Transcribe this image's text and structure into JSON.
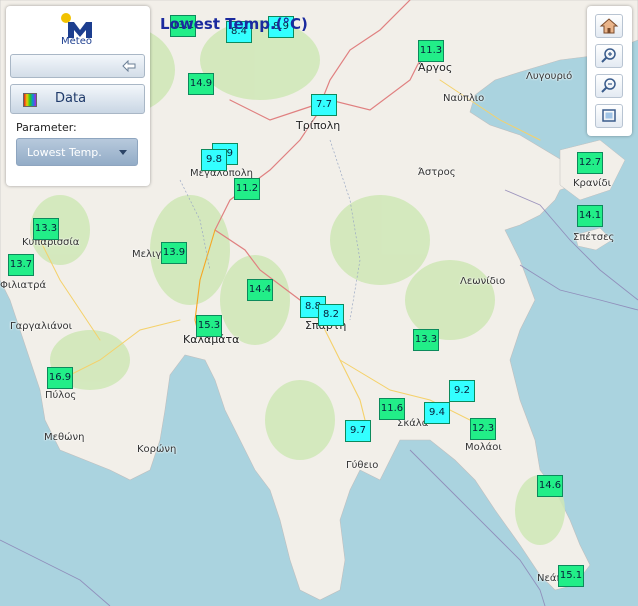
{
  "map_title": "Lowest Temp.(°C)",
  "panel": {
    "logo_text": "Meteo",
    "data_button_label": "Data",
    "parameter_label": "Parameter:",
    "parameter_selected": "Lowest Temp."
  },
  "controls": {
    "home_icon": "home-icon",
    "zoom_in_icon": "zoom-in-icon",
    "zoom_out_icon": "zoom-out-icon",
    "extent_icon": "zoom-extent-icon"
  },
  "colors": {
    "sea": "#aad3df",
    "land": "#f2efe9",
    "marker_cyan": "#33ffff",
    "marker_green": "#22ee88",
    "title": "#1b2a9e"
  },
  "places": [
    "Άργος",
    "Ναύπλιο",
    "Λυγουριό",
    "Τρίπολη",
    "Άστρος",
    "Μεγαλόπολη",
    "Κρανίδι",
    "Σπέτσες",
    "Κυπαρισσία",
    "Μελιγαλάς",
    "Φιλιατρά",
    "Λεωνίδιο",
    "Γαργαλιάνοι",
    "Σπάρτη",
    "Καλαμάτα",
    "Πύλος",
    "Μεθώνη",
    "Κορώνη",
    "Σκάλα",
    "Μολάοι",
    "Γύθειο",
    "Νεάπολη"
  ],
  "stations": [
    "13.1",
    "8.4",
    "8.9",
    "11.3",
    "14.9",
    "7.7",
    "8.9",
    "9.8",
    "11.2",
    "12.7",
    "14.1",
    "13.3",
    "13.9",
    "13.7",
    "14.4",
    "8.8",
    "8.2",
    "15.3",
    "13.3",
    "16.9",
    "9.2",
    "11.6",
    "9.4",
    "9.7",
    "12.3",
    "14.6",
    "15.1"
  ]
}
